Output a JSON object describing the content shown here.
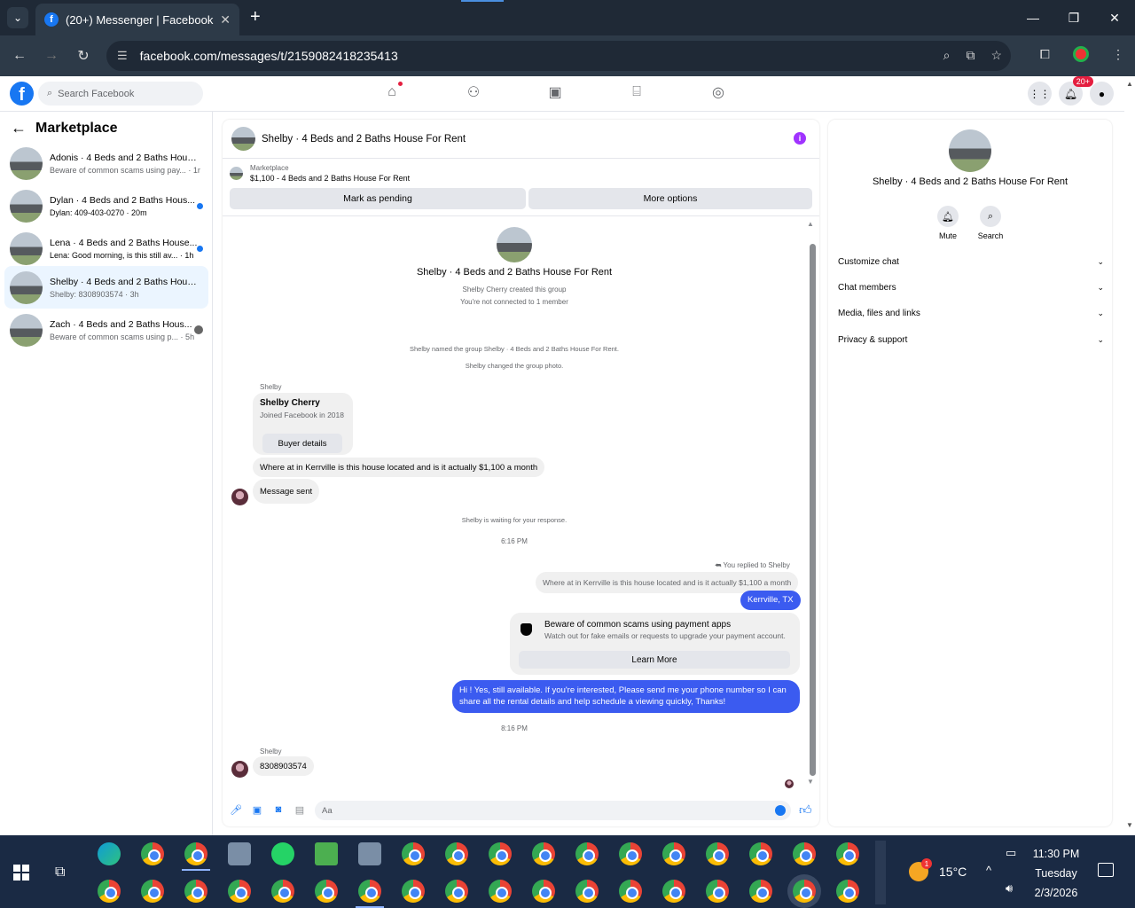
{
  "browser": {
    "tab_title": "(20+) Messenger | Facebook",
    "url": "facebook.com/messages/t/2159082418235413",
    "new_tab": "+",
    "tab_close": "✕",
    "win_min": "—",
    "win_max": "❐",
    "win_close": "✕"
  },
  "fb": {
    "search_placeholder": "Search Facebook",
    "notif_badge": "20+"
  },
  "sidebar": {
    "title": "Marketplace",
    "conversations": [
      {
        "name": "Adonis · 4 Beds and 2 Baths House...",
        "snippet": "Beware of common scams using pay... · 1m",
        "unread": false
      },
      {
        "name": "Dylan · 4 Beds and 2 Baths Hous...",
        "snippet": "Dylan: 409-403-0270 · 20m",
        "unread": true
      },
      {
        "name": "Lena · 4 Beds and 2 Baths House...",
        "snippet": "Lena: Good morning, is this still av... · 1h",
        "unread": true
      },
      {
        "name": "Shelby · 4 Beds and 2 Baths House...",
        "snippet": "Shelby: 8308903574 · 3h",
        "unread": false
      },
      {
        "name": "Zach · 4 Beds and 2 Baths Hous...",
        "snippet": "Beware of common scams using p... · 5h",
        "unread": false
      }
    ]
  },
  "chat": {
    "title": "Shelby · 4 Beds and 2 Baths House For Rent",
    "marketplace_label": "Marketplace",
    "listing": "$1,100 - 4 Beds and 2 Baths House For Rent",
    "btn_pending": "Mark as pending",
    "btn_more": "More options",
    "group_title": "Shelby · 4 Beds and 2 Baths House For Rent",
    "created": "Shelby Cherry created this group",
    "not_connected": "You're not connected to 1 member",
    "named_group": "Shelby named the group Shelby · 4 Beds and 2 Baths House For Rent.",
    "changed_photo": "Shelby changed the group photo.",
    "sender1": "Shelby",
    "card_name": "Shelby Cherry",
    "card_sub": "Joined Facebook in 2018",
    "card_btn": "Buyer details",
    "msg_question": "Where at in Kerrville is this house located and is it actually $1,100 a month",
    "msg_sent": "Message sent",
    "waiting": "Shelby is waiting for your response.",
    "time1": "6:16 PM",
    "replied_to": "You replied to Shelby",
    "quoted": "Where at in Kerrville is this house located and is it actually $1,100 a month",
    "reply": "Kerrville, TX",
    "warn_title": "Beware of common scams using payment apps",
    "warn_sub": "Watch out for fake emails or requests to upgrade your payment account.",
    "learn_more": "Learn More",
    "long_reply": "Hi ! Yes, still available. If you're interested, Please send me your phone number so I can share all the rental details and help schedule a viewing quickly, Thanks!",
    "time2": "8:16 PM",
    "sender2": "Shelby",
    "phone_msg": "8308903574",
    "composer_placeholder": "Aa"
  },
  "details": {
    "title": "Shelby · 4 Beds and 2 Baths House For Rent",
    "mute": "Mute",
    "search": "Search",
    "sections": [
      "Customize chat",
      "Chat members",
      "Media, files and links",
      "Privacy & support"
    ]
  },
  "taskbar": {
    "temp": "15°C",
    "weather_badge": "1",
    "time": "11:30 PM",
    "day": "Tuesday",
    "date": "2/3/2026"
  }
}
